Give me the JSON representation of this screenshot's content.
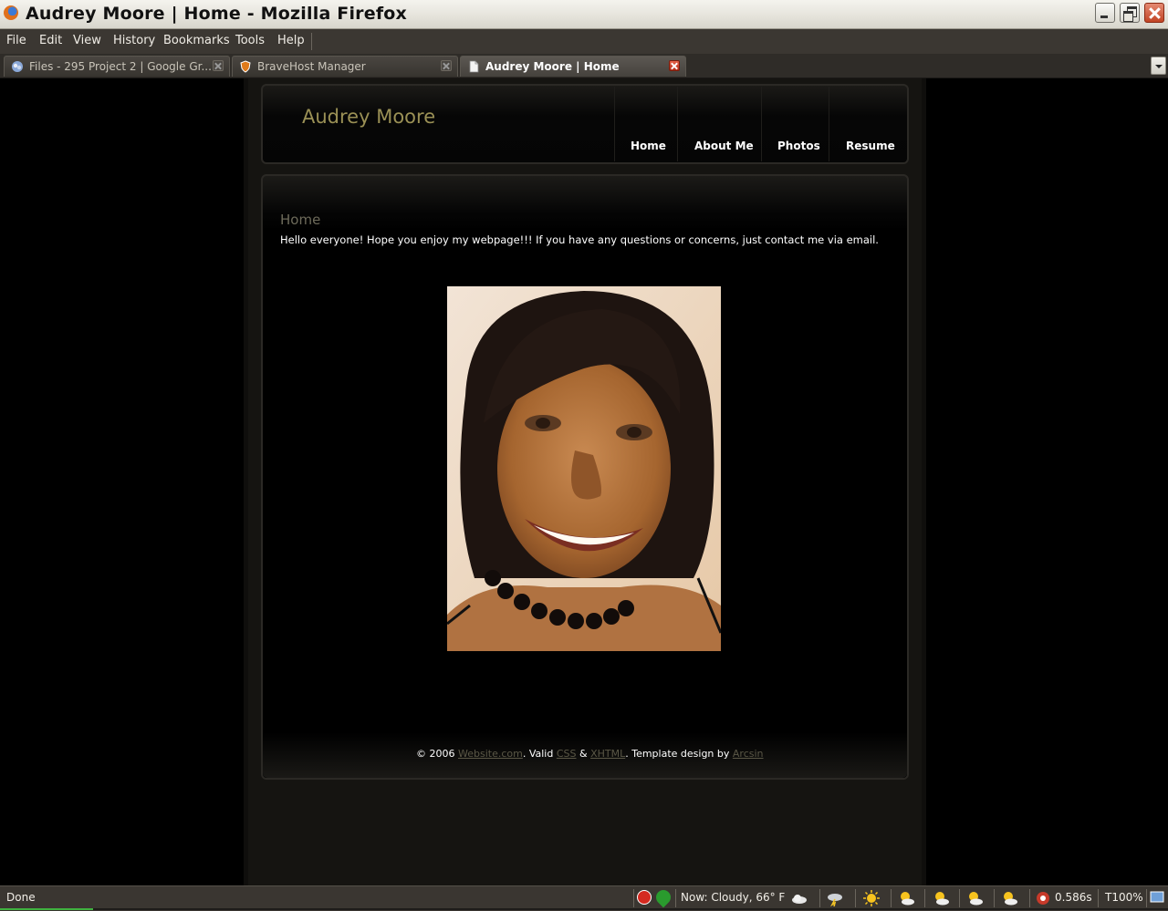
{
  "window": {
    "title": "Audrey Moore  | Home - Mozilla Firefox"
  },
  "menu": {
    "items": [
      "File",
      "Edit",
      "View",
      "History",
      "Bookmarks",
      "Tools",
      "Help"
    ]
  },
  "tabs": [
    {
      "label": "Files - 295 Project 2 | Google Gr...",
      "icon": "google-groups-icon",
      "active": false
    },
    {
      "label": "BraveHost Manager",
      "icon": "bravehost-shield-icon",
      "active": false
    },
    {
      "label": "Audrey Moore | Home",
      "icon": "page-icon",
      "active": true
    }
  ],
  "site": {
    "title": "Audrey Moore",
    "nav": [
      "Home",
      "About Me",
      "Photos",
      "Resume"
    ],
    "heading": "Home",
    "intro": "Hello everyone! Hope you enjoy my webpage!!!  If you have any questions or concerns, just contact me via email.",
    "footer": {
      "copyright": "© 2006 ",
      "site_link": "Website.com",
      "valid": ". Valid ",
      "css_link": "CSS",
      "amp": " & ",
      "xhtml_link": "XHTML",
      "template": ". Template design by ",
      "designer_link": "Arcsin"
    }
  },
  "status": {
    "text": "Done",
    "weather": "Now: Cloudy, 66° F",
    "load_time": "0.586s",
    "zoom": "T100%",
    "progress_fraction": 0.08
  },
  "colors": {
    "accent_title": "#9a9055",
    "heading": "#6d6a5a",
    "link": "#5a5746",
    "chrome": "#3a3631"
  }
}
